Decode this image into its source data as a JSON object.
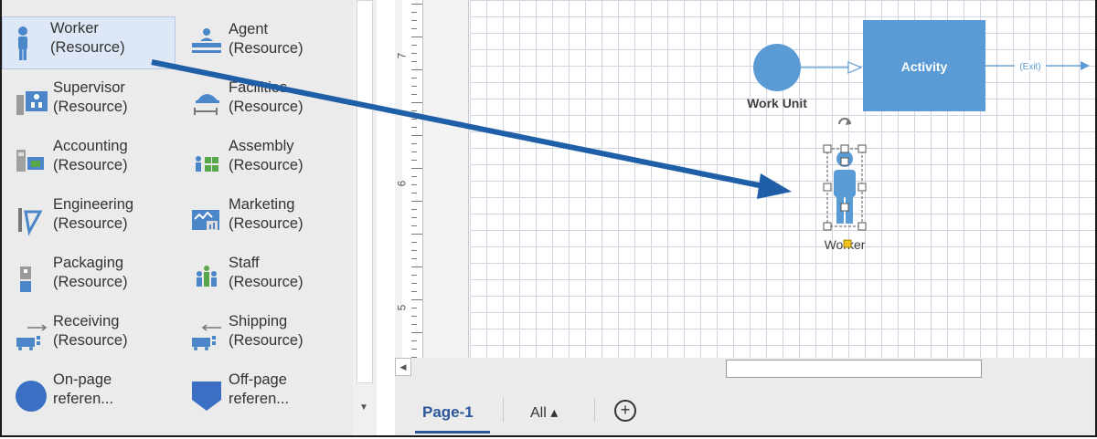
{
  "stencil": {
    "items": [
      {
        "label": "Worker\n(Resource)",
        "icon": "worker-icon",
        "selected": true
      },
      {
        "label": "Agent\n(Resource)",
        "icon": "agent-icon"
      },
      {
        "label": "Supervisor\n(Resource)",
        "icon": "supervisor-icon"
      },
      {
        "label": "Facilities\n(Resource)",
        "icon": "facilities-icon"
      },
      {
        "label": "Accounting\n(Resource)",
        "icon": "accounting-icon"
      },
      {
        "label": "Assembly\n(Resource)",
        "icon": "assembly-icon"
      },
      {
        "label": "Engineering\n(Resource)",
        "icon": "engineering-icon"
      },
      {
        "label": "Marketing\n(Resource)",
        "icon": "marketing-icon"
      },
      {
        "label": "Packaging\n(Resource)",
        "icon": "packaging-icon"
      },
      {
        "label": "Staff\n(Resource)",
        "icon": "staff-icon"
      },
      {
        "label": "Receiving\n(Resource)",
        "icon": "receiving-icon"
      },
      {
        "label": "Shipping\n(Resource)",
        "icon": "shipping-icon"
      },
      {
        "label": "On-page\nreferen...",
        "icon": "on-page-reference-icon"
      },
      {
        "label": "Off-page\nreferen...",
        "icon": "off-page-reference-icon"
      }
    ]
  },
  "ruler": {
    "labels": [
      "7",
      "6",
      "5"
    ]
  },
  "diagram": {
    "work_unit_label": "Work Unit",
    "activity_label": "Activity",
    "exit_label": "(Exit)",
    "worker_label": "Worker",
    "shape_color": "#5b9bd5",
    "arrow_color": "#1f5fa8"
  },
  "tabs": {
    "page_label": "Page-1",
    "all_label": "All ▴",
    "add_label": "+"
  }
}
